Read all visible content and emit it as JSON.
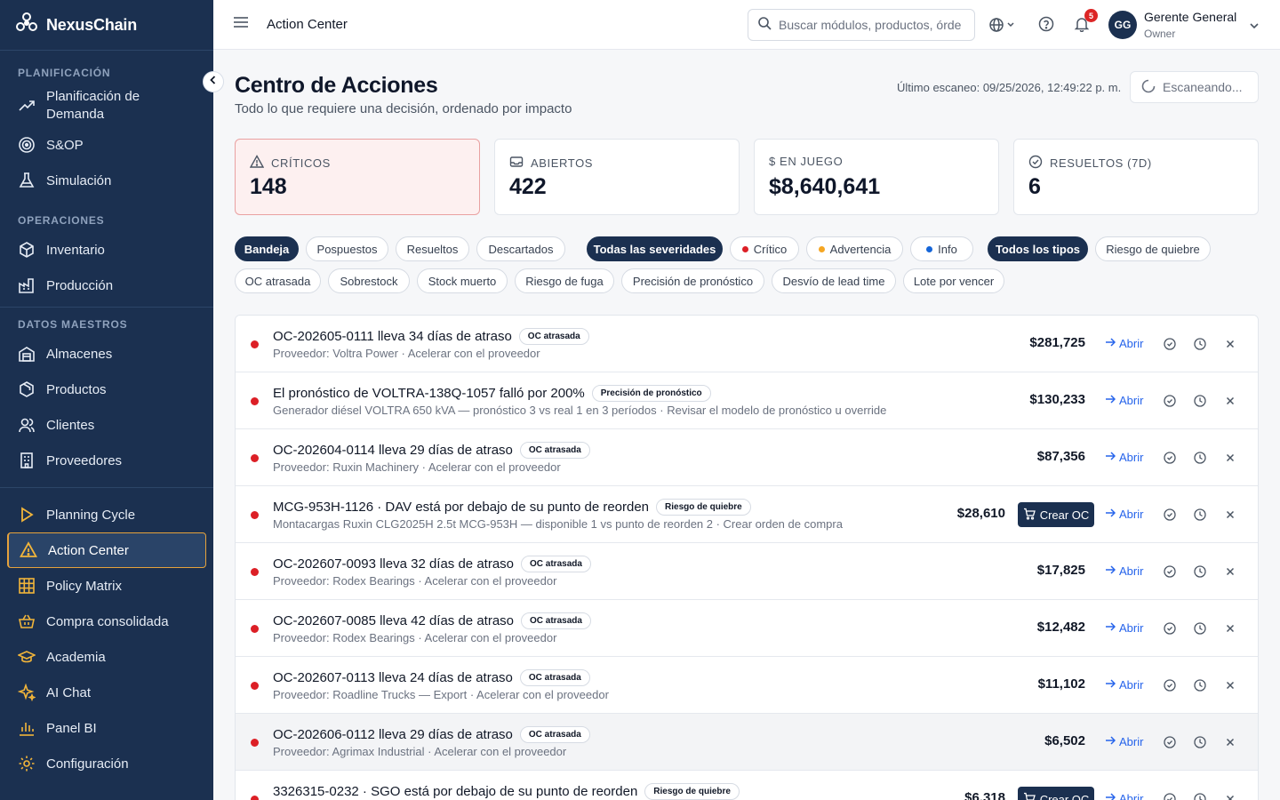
{
  "brand": {
    "name": "NexusChain"
  },
  "sidebar": {
    "sections": [
      {
        "title": "PLANIFICACIÓN",
        "items": [
          "Planificación de Demanda",
          "S&OP",
          "Simulación"
        ]
      },
      {
        "title": "OPERACIONES",
        "items": [
          "Inventario",
          "Producción"
        ]
      },
      {
        "title": "DATOS MAESTROS",
        "items": [
          "Almacenes",
          "Productos",
          "Clientes",
          "Proveedores"
        ]
      }
    ],
    "extra": [
      "Planning Cycle",
      "Action Center",
      "Policy Matrix",
      "Compra consolidada",
      "Academia",
      "AI Chat",
      "Panel BI",
      "Configuración"
    ],
    "plan_line1": "Planificación de",
    "plan_line2": "Demanda"
  },
  "topbar": {
    "title": "Action Center",
    "search_placeholder": "Buscar módulos, productos, órdenes...",
    "notif_count": "5",
    "avatar_initials": "GG",
    "user_name": "Gerente General",
    "user_role": "Owner"
  },
  "page": {
    "title": "Centro de Acciones",
    "subtitle": "Todo lo que requiere una decisión, ordenado por impacto",
    "last_scan": "Último escaneo: 09/25/2026, 12:49:22 p. m.",
    "scan_button": "Escaneando..."
  },
  "kpis": [
    {
      "label": "CRÍTICOS",
      "value": "148"
    },
    {
      "label": "ABIERTOS",
      "value": "422"
    },
    {
      "label": "$ EN JUEGO",
      "value": "$8,640,641"
    },
    {
      "label": "RESUELTOS (7D)",
      "value": "6"
    }
  ],
  "filters": {
    "status": [
      "Bandeja",
      "Pospuestos",
      "Resueltos",
      "Descartados"
    ],
    "severity": [
      "Todas las severidades",
      "Crítico",
      "Advertencia",
      "Info"
    ],
    "types": [
      "Todos los tipos",
      "Riesgo de quiebre",
      "OC atrasada",
      "Sobrestock",
      "Stock muerto",
      "Riesgo de fuga",
      "Precisión de pronóstico",
      "Desvío de lead time",
      "Lote por vencer"
    ]
  },
  "colors": {
    "critical": "#dc1f26",
    "warning": "#f5a623",
    "info": "#1565d8",
    "navy": "#1b3050"
  },
  "actions": {
    "open_label": "Abrir",
    "create_po_label": "Crear OC",
    "rows": [
      {
        "title": "OC-202605-0111 lleva 34 días de atraso",
        "tag": "OC atrasada",
        "sub": "Proveedor: Voltra Power · Acelerar con el proveedor",
        "amount": "$281,725"
      },
      {
        "title": "El pronóstico de VOLTRA-138Q-1057 falló por 200%",
        "tag": "Precisión de pronóstico",
        "sub": "Generador diésel VOLTRA 650 kVA — pronóstico 3 vs real 1 en 3 períodos · Revisar el modelo de pronóstico u override",
        "amount": "$130,233"
      },
      {
        "title": "OC-202604-0114 lleva 29 días de atraso",
        "tag": "OC atrasada",
        "sub": "Proveedor: Ruxin Machinery · Acelerar con el proveedor",
        "amount": "$87,356"
      },
      {
        "title": "MCG-953H-1126 · DAV está por debajo de su punto de reorden",
        "tag": "Riesgo de quiebre",
        "sub": "Montacargas Ruxin CLG2025H 2.5t MCG-953H — disponible 1 vs punto de reorden 2 · Crear orden de compra",
        "amount": "$28,610"
      },
      {
        "title": "OC-202607-0093 lleva 32 días de atraso",
        "tag": "OC atrasada",
        "sub": "Proveedor: Rodex Bearings · Acelerar con el proveedor",
        "amount": "$17,825"
      },
      {
        "title": "OC-202607-0085 lleva 42 días de atraso",
        "tag": "OC atrasada",
        "sub": "Proveedor: Rodex Bearings · Acelerar con el proveedor",
        "amount": "$12,482"
      },
      {
        "title": "OC-202607-0113 lleva 24 días de atraso",
        "tag": "OC atrasada",
        "sub": "Proveedor: Roadline Trucks — Export · Acelerar con el proveedor",
        "amount": "$11,102"
      },
      {
        "title": "OC-202606-0112 lleva 29 días de atraso",
        "tag": "OC atrasada",
        "sub": "Proveedor: Agrimax Industrial · Acelerar con el proveedor",
        "amount": "$6,502"
      },
      {
        "title": "3326315-0232 · SGO está por debajo de su punto de reorden",
        "tag": "Riesgo de quiebre",
        "sub": "",
        "amount": "$6,318"
      }
    ]
  }
}
